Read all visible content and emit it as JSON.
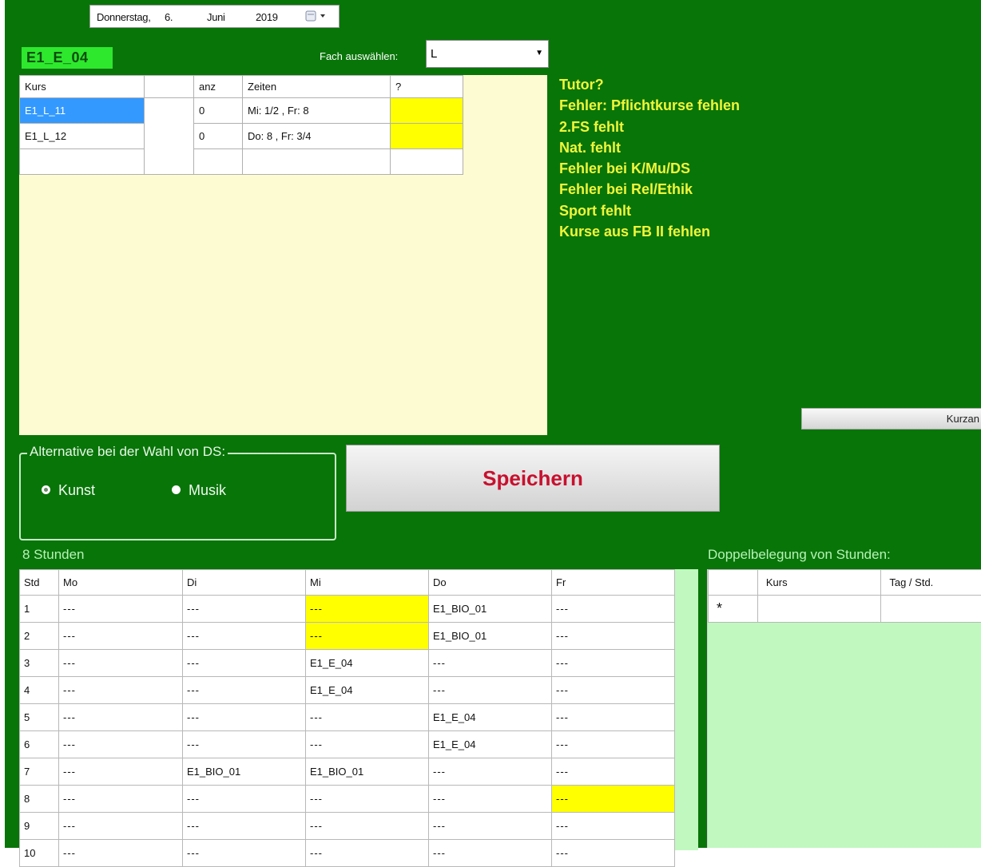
{
  "datepicker": {
    "weekday": "Donnerstag,",
    "day": "6.",
    "month": "Juni",
    "year": "2019",
    "button_icon": "calendar-dropdown-icon"
  },
  "class_badge": "E1_E_04",
  "fach": {
    "label": "Fach auswählen:",
    "selected": "L"
  },
  "course_grid": {
    "headers": [
      "Kurs",
      "",
      "anz",
      "Zeiten",
      "?"
    ],
    "rows": [
      {
        "kurs": "E1_L_11",
        "extra": "",
        "anz": "0",
        "zeiten": "Mi: 1/2 , Fr: 8",
        "q": ""
      },
      {
        "kurs": "E1_L_12",
        "extra": "",
        "anz": "0",
        "zeiten": "Do: 8 , Fr: 3/4",
        "q": ""
      }
    ]
  },
  "messages": [
    "Tutor?",
    "Fehler: Pflichtkurse fehlen",
    "2.FS fehlt",
    "Nat. fehlt",
    "Fehler bei K/Mu/DS",
    "Fehler bei Rel/Ethik",
    "Sport fehlt",
    "Kurse aus FB II fehlen"
  ],
  "kurzan_button": "Kurzan",
  "alternative": {
    "title": "Alternative bei der Wahl von DS:",
    "option_kunst": "Kunst",
    "option_musik": "Musik",
    "selected": "Kunst"
  },
  "save_button": "Speichern",
  "timetable": {
    "label": "8 Stunden",
    "headers": [
      "Std",
      "Mo",
      "Di",
      "Mi",
      "Do",
      "Fr"
    ],
    "rows": [
      [
        "1",
        "---",
        "---",
        "---",
        "E1_BIO_01",
        "---"
      ],
      [
        "2",
        "---",
        "---",
        "---",
        "E1_BIO_01",
        "---"
      ],
      [
        "3",
        "---",
        "---",
        "E1_E_04",
        "---",
        "---"
      ],
      [
        "4",
        "---",
        "---",
        "E1_E_04",
        "---",
        "---"
      ],
      [
        "5",
        "---",
        "---",
        "---",
        "E1_E_04",
        "---"
      ],
      [
        "6",
        "---",
        "---",
        "---",
        "E1_E_04",
        "---"
      ],
      [
        "7",
        "---",
        "E1_BIO_01",
        "E1_BIO_01",
        "---",
        "---"
      ],
      [
        "8",
        "---",
        "---",
        "---",
        "---",
        "---"
      ],
      [
        "9",
        "---",
        "---",
        "---",
        "---",
        "---"
      ],
      [
        "10",
        "---",
        "---",
        "---",
        "---",
        "---"
      ]
    ]
  },
  "doppelbelegung": {
    "label": "Doppelbelegung von Stunden:",
    "headers": [
      "",
      "Kurs",
      "Tag / Std."
    ],
    "new_row_marker": "*"
  },
  "colors": {
    "window_bg": "#087508",
    "highlight": "#ffff00",
    "selection": "#3399ff",
    "message_text": "#f1f53b",
    "save_text": "#c8102e"
  }
}
